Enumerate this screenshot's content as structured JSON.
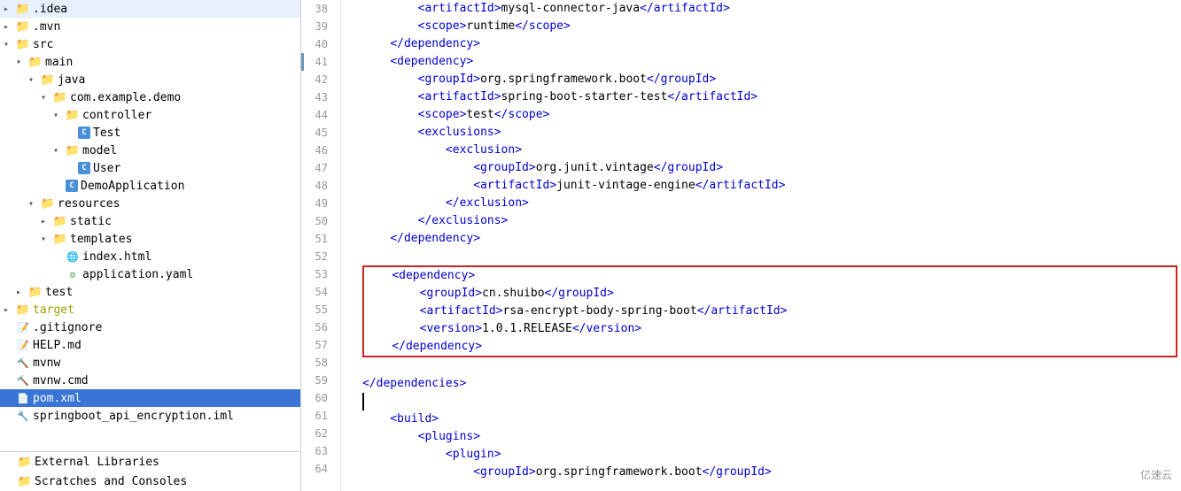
{
  "sidebar": {
    "items": [
      {
        "id": "idea",
        "label": ".idea",
        "indent": 4,
        "arrow": "closed",
        "icon": "folder",
        "level": 0
      },
      {
        "id": "mvn",
        "label": ".mvn",
        "indent": 4,
        "arrow": "closed",
        "icon": "folder",
        "level": 0
      },
      {
        "id": "src",
        "label": "src",
        "indent": 4,
        "arrow": "open",
        "icon": "folder",
        "level": 0
      },
      {
        "id": "main",
        "label": "main",
        "indent": 18,
        "arrow": "open",
        "icon": "folder",
        "level": 1
      },
      {
        "id": "java",
        "label": "java",
        "indent": 32,
        "arrow": "open",
        "icon": "folder-special",
        "level": 2
      },
      {
        "id": "com",
        "label": "com.example.demo",
        "indent": 46,
        "arrow": "open",
        "icon": "folder",
        "level": 3
      },
      {
        "id": "controller",
        "label": "controller",
        "indent": 60,
        "arrow": "open",
        "icon": "folder",
        "level": 4
      },
      {
        "id": "Test",
        "label": "Test",
        "indent": 74,
        "arrow": "empty",
        "icon": "java",
        "level": 5
      },
      {
        "id": "model",
        "label": "model",
        "indent": 60,
        "arrow": "open",
        "icon": "folder",
        "level": 4
      },
      {
        "id": "User",
        "label": "User",
        "indent": 74,
        "arrow": "empty",
        "icon": "java",
        "level": 5
      },
      {
        "id": "DemoApplication",
        "label": "DemoApplication",
        "indent": 60,
        "arrow": "empty",
        "icon": "java-special",
        "level": 4
      },
      {
        "id": "resources",
        "label": "resources",
        "indent": 32,
        "arrow": "open",
        "icon": "folder-special",
        "level": 2
      },
      {
        "id": "static",
        "label": "static",
        "indent": 46,
        "arrow": "closed",
        "icon": "folder",
        "level": 3
      },
      {
        "id": "templates",
        "label": "templates",
        "indent": 46,
        "arrow": "open",
        "icon": "folder",
        "level": 3
      },
      {
        "id": "index.html",
        "label": "index.html",
        "indent": 60,
        "arrow": "empty",
        "icon": "html",
        "level": 4
      },
      {
        "id": "application.yaml",
        "label": "application.yaml",
        "indent": 60,
        "arrow": "empty",
        "icon": "yaml",
        "level": 4
      },
      {
        "id": "test",
        "label": "test",
        "indent": 18,
        "arrow": "closed",
        "icon": "folder",
        "level": 1
      },
      {
        "id": "target",
        "label": "target",
        "indent": 4,
        "arrow": "closed",
        "icon": "folder-target",
        "level": 0
      },
      {
        "id": "gitignore",
        "label": ".gitignore",
        "indent": 4,
        "arrow": "empty",
        "icon": "git",
        "level": 0
      },
      {
        "id": "HELP",
        "label": "HELP.md",
        "indent": 4,
        "arrow": "empty",
        "icon": "md",
        "level": 0
      },
      {
        "id": "mvnw",
        "label": "mvnw",
        "indent": 4,
        "arrow": "empty",
        "icon": "mvn",
        "level": 0
      },
      {
        "id": "mvnwcmd",
        "label": "mvnw.cmd",
        "indent": 4,
        "arrow": "empty",
        "icon": "mvn",
        "level": 0
      },
      {
        "id": "pomxml",
        "label": "pom.xml",
        "indent": 4,
        "arrow": "empty",
        "icon": "xml",
        "selected": true,
        "level": 0
      },
      {
        "id": "iml",
        "label": "springboot_api_encryption.iml",
        "indent": 4,
        "arrow": "empty",
        "icon": "iml",
        "level": 0
      }
    ],
    "footer": [
      {
        "id": "ext-lib",
        "label": "External Libraries",
        "icon": "folder"
      },
      {
        "id": "scratches",
        "label": "Scratches and Consoles",
        "icon": "folder"
      }
    ]
  },
  "editor": {
    "lines": [
      {
        "num": 38,
        "content": "        <artifactId>mysql-connector-java</artifactId>"
      },
      {
        "num": 39,
        "content": "        <scope>runtime</scope>"
      },
      {
        "num": 40,
        "content": "    </dependency>"
      },
      {
        "num": 41,
        "content": "    <dependency>",
        "modified": true
      },
      {
        "num": 42,
        "content": "        <groupId>org.springframework.boot</groupId>"
      },
      {
        "num": 43,
        "content": "        <artifactId>spring-boot-starter-test</artifactId>"
      },
      {
        "num": 44,
        "content": "        <scope>test</scope>"
      },
      {
        "num": 45,
        "content": "        <exclusions>"
      },
      {
        "num": 46,
        "content": "            <exclusion>"
      },
      {
        "num": 47,
        "content": "                <groupId>org.junit.vintage</groupId>"
      },
      {
        "num": 48,
        "content": "                <artifactId>junit-vintage-engine</artifactId>"
      },
      {
        "num": 49,
        "content": "            </exclusion>"
      },
      {
        "num": 50,
        "content": "        </exclusions>"
      },
      {
        "num": 51,
        "content": "    </dependency>"
      },
      {
        "num": 52,
        "content": ""
      },
      {
        "num": 53,
        "content": "    <dependency>",
        "boxStart": true
      },
      {
        "num": 54,
        "content": "        <groupId>cn.shuibo</groupId>"
      },
      {
        "num": 55,
        "content": "        <artifactId>rsa-encrypt-body-spring-boot</artifactId>"
      },
      {
        "num": 56,
        "content": "        <version>1.0.1.RELEASE</version>"
      },
      {
        "num": 57,
        "content": "    </dependency>",
        "boxEnd": true
      },
      {
        "num": 58,
        "content": ""
      },
      {
        "num": 59,
        "content": "</dependencies>"
      },
      {
        "num": 60,
        "content": "",
        "cursor": true
      },
      {
        "num": 61,
        "content": "    <build>"
      },
      {
        "num": 62,
        "content": "        <plugins>"
      },
      {
        "num": 63,
        "content": "            <plugin>"
      },
      {
        "num": 64,
        "content": "                <groupId>org.springframework.boot</groupId>"
      }
    ]
  },
  "watermark": "亿速云"
}
